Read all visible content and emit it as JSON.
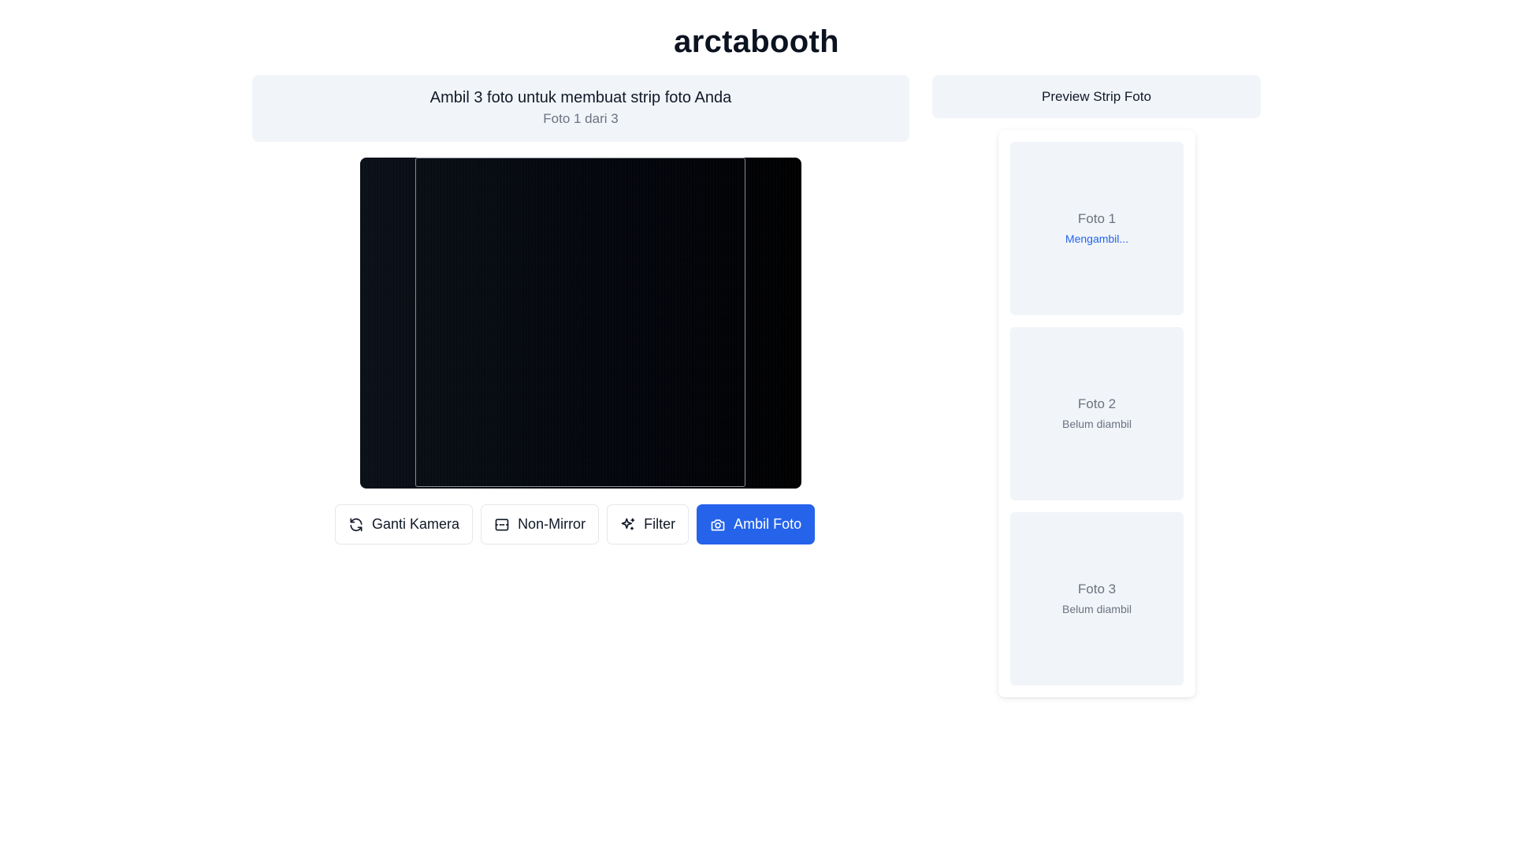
{
  "app": {
    "title": "arctabooth"
  },
  "banner": {
    "instruction": "Ambil 3 foto untuk membuat strip foto Anda",
    "progress": "Foto 1 dari 3"
  },
  "controls": {
    "switch_camera": {
      "label": "Ganti Kamera",
      "icon": "refresh-icon"
    },
    "mirror": {
      "label": "Non-Mirror",
      "icon": "flip-icon"
    },
    "filter": {
      "label": "Filter",
      "icon": "sparkles-icon"
    },
    "capture": {
      "label": "Ambil Foto",
      "icon": "camera-icon"
    }
  },
  "preview": {
    "header": "Preview Strip Foto",
    "slots": [
      {
        "label": "Foto 1",
        "status": "Mengambil..."
      },
      {
        "label": "Foto 2",
        "status": "Belum diambil"
      },
      {
        "label": "Foto 3",
        "status": "Belum diambil"
      }
    ]
  },
  "colors": {
    "accent": "#2563eb",
    "panel": "#f1f5f9",
    "muted_text": "#6b7280"
  }
}
